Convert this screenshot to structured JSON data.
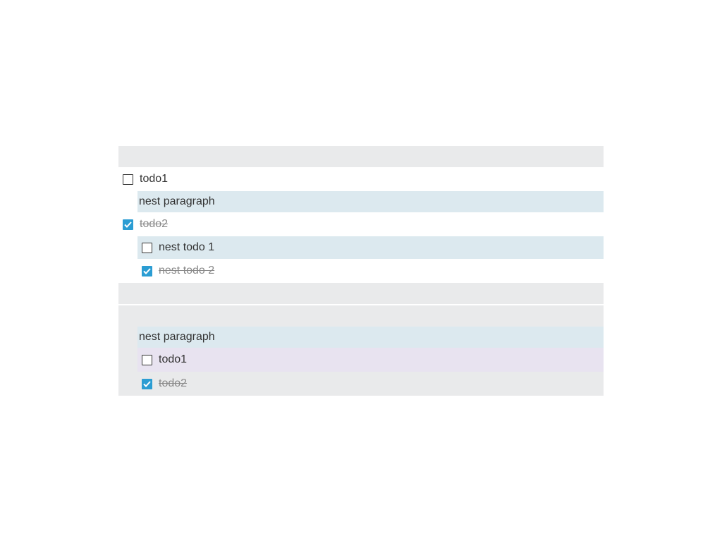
{
  "first_list": {
    "todo1": {
      "label": "todo1",
      "checked": false
    },
    "para1": {
      "text": "nest paragraph"
    },
    "todo2": {
      "label": "todo2",
      "checked": true
    },
    "nested": [
      {
        "label": "nest todo 1",
        "checked": false
      },
      {
        "label": "nest todo 2",
        "checked": true
      }
    ]
  },
  "second_group": {
    "para": {
      "text": "nest paragraph"
    },
    "todos": [
      {
        "label": "todo1",
        "checked": false
      },
      {
        "label": "todo2",
        "checked": true
      }
    ]
  },
  "colors": {
    "checkbox_checked": "#2b9dd3",
    "block_grey": "#e9eaeb",
    "highlight_blue": "#dce9ef",
    "highlight_purple": "#e8e3f0"
  }
}
